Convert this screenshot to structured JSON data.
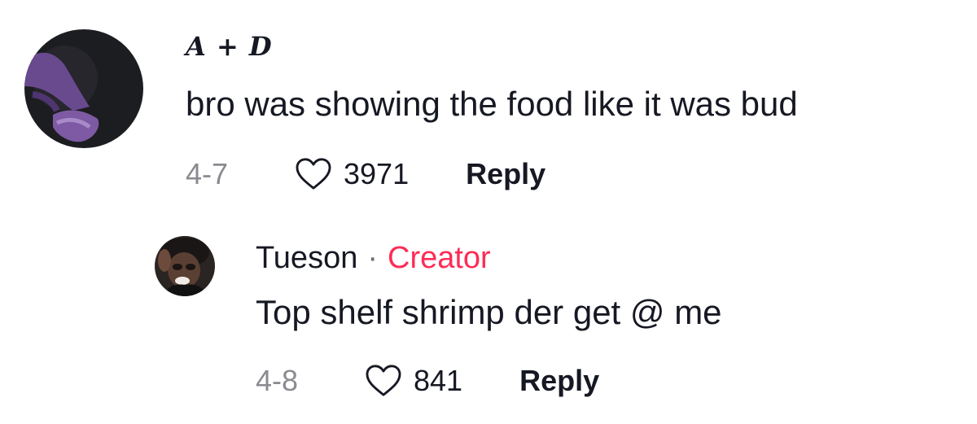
{
  "comments": [
    {
      "username": "A + D",
      "text": "bro was showing the food like it was bud",
      "date": "4-7",
      "likes": "3971",
      "reply_label": "Reply"
    }
  ],
  "replies": [
    {
      "username": "Tueson",
      "separator": "·",
      "badge": "Creator",
      "text": "Top shelf shrimp der get @ me",
      "date": "4-8",
      "likes": "841",
      "reply_label": "Reply"
    }
  ],
  "icons": {
    "like": "heart-outline-icon"
  },
  "colors": {
    "creator_badge": "#fe2c55",
    "secondary_text": "#8a8b91",
    "primary_text": "#161823"
  }
}
